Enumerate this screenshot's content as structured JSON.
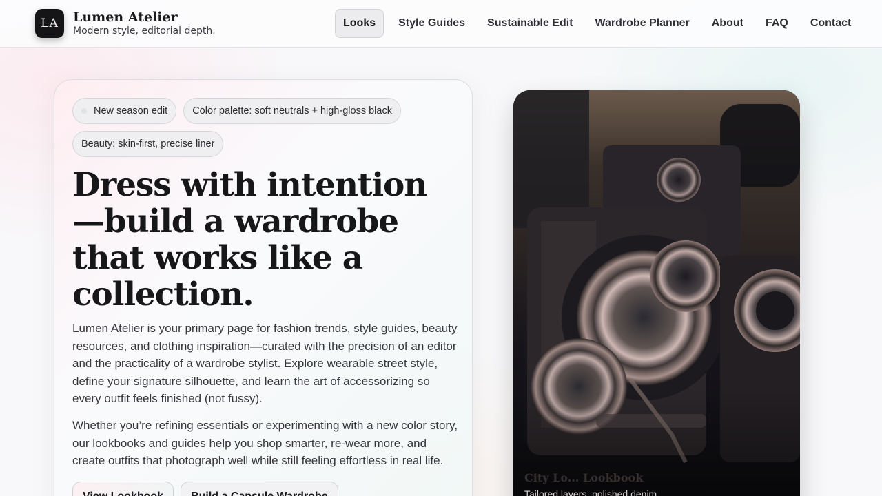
{
  "brand": {
    "logo": "LA",
    "name": "Lumen Atelier",
    "tagline": "Modern style, editorial depth."
  },
  "nav": {
    "items": [
      "Looks",
      "Style Guides",
      "Sustainable Edit",
      "Wardrobe Planner",
      "About",
      "FAQ",
      "Contact"
    ],
    "active": "Looks"
  },
  "hero": {
    "chips": [
      "New season edit",
      "Color palette: soft neutrals + high-gloss black",
      "Beauty: skin-first, precise liner"
    ],
    "headline": "Dress with intention—build a wardrobe that works like a collection.",
    "paragraph1": "Lumen Atelier is your primary page for fashion trends, style guides, beauty resources, and clothing inspiration—curated with the precision of an editor and the practicality of a wardrobe stylist. Explore wearable street style, define your signature silhouette, and learn the art of accessorizing so every outfit feels finished (not fussy).",
    "paragraph2": "Whether you’re refining essentials or experimenting with a new color story, our lookbooks and guides help you shop smarter, re-wear more, and create outfits that photograph well while still feeling effortless in real life.",
    "cta_primary": "View Lookbook",
    "cta_secondary": "Build a Capsule Wardrobe"
  },
  "feature_image": {
    "caption_title": "City Lo... Lookbook",
    "caption_sub": "Tailored layers, polished denim"
  },
  "colors": {
    "ink": "#17171a",
    "logo_bg": "#151518",
    "photo_bg": "#17151a"
  }
}
